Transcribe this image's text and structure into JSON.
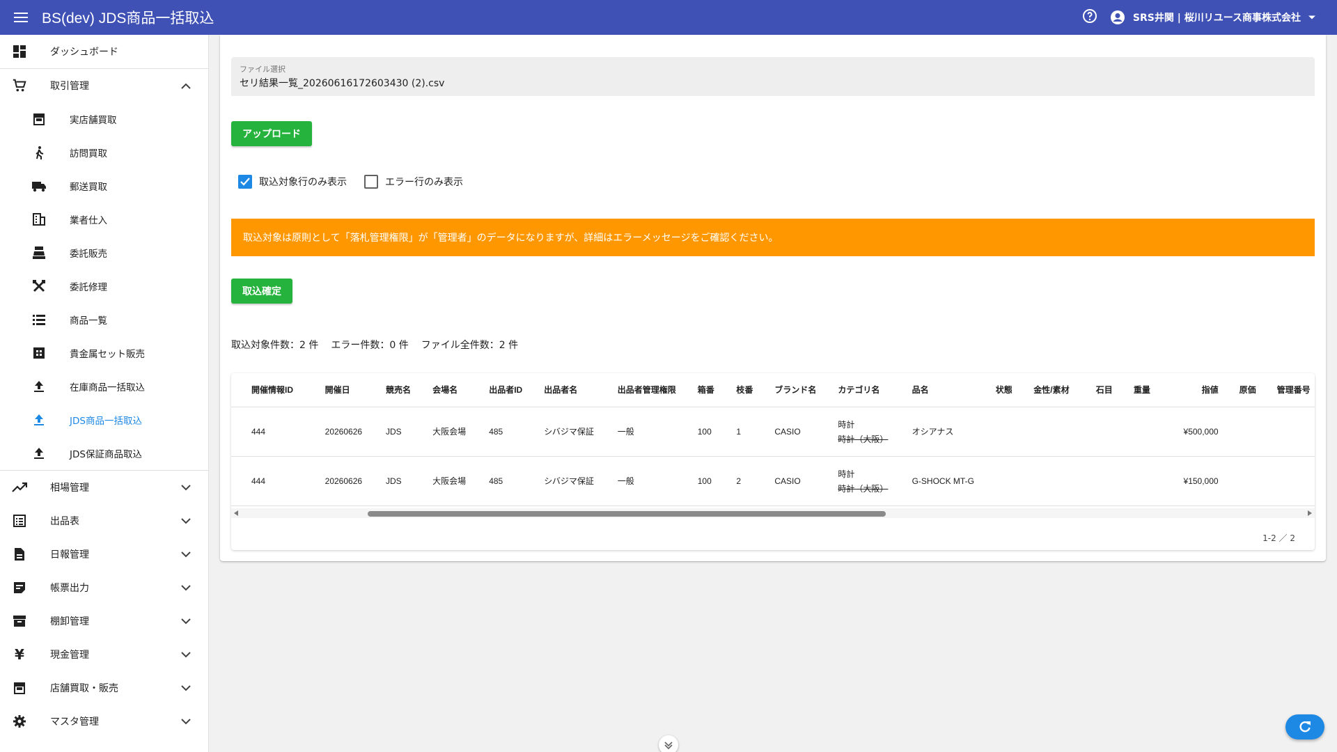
{
  "appbar": {
    "title": "BS(dev) JDS商品一括取込",
    "user": "SRS井関 | 桜川リユース商事株式会社"
  },
  "sidebar": {
    "items": [
      {
        "label": "ダッシュボード",
        "icon": "dashboard-icon"
      },
      {
        "label": "取引管理",
        "icon": "cart-icon"
      },
      {
        "label": "実店舗買取",
        "icon": "store-icon"
      },
      {
        "label": "訪問買取",
        "icon": "walk-icon"
      },
      {
        "label": "郵送買取",
        "icon": "truck-icon"
      },
      {
        "label": "業者仕入",
        "icon": "building-icon"
      },
      {
        "label": "委託販売",
        "icon": "register-icon"
      },
      {
        "label": "委託修理",
        "icon": "tools-icon"
      },
      {
        "label": "商品一覧",
        "icon": "list-icon"
      },
      {
        "label": "貴金属セット販売",
        "icon": "grid-icon"
      },
      {
        "label": "在庫商品一括取込",
        "icon": "upload-icon"
      },
      {
        "label": "JDS商品一括取込",
        "icon": "upload-icon"
      },
      {
        "label": "JDS保証商品取込",
        "icon": "upload-icon"
      },
      {
        "label": "相場管理",
        "icon": "trend-icon"
      },
      {
        "label": "出品表",
        "icon": "listalt-icon"
      },
      {
        "label": "日報管理",
        "icon": "document-icon"
      },
      {
        "label": "帳票出力",
        "icon": "note-icon"
      },
      {
        "label": "棚卸管理",
        "icon": "archive-icon"
      },
      {
        "label": "現金管理",
        "icon": "yen-icon"
      },
      {
        "label": "店舗買取・販売",
        "icon": "store-icon"
      },
      {
        "label": "マスタ管理",
        "icon": "gear-icon"
      }
    ]
  },
  "file": {
    "label": "ファイル選択",
    "value": "セリ結果一覧_20260616172603430 (2).csv"
  },
  "buttons": {
    "upload": "アップロード",
    "confirm": "取込確定"
  },
  "filters": {
    "target_only": "取込対象行のみ表示",
    "target_only_checked": true,
    "error_only": "エラー行のみ表示",
    "error_only_checked": false
  },
  "alert": "取込対象は原則として「落札管理権限」が「管理者」のデータになりますが、詳細はエラーメッセージをご確認ください。",
  "counts": {
    "target": "取込対象件数：2 件",
    "error": "エラー件数：0 件",
    "total": "ファイル全件数：2 件"
  },
  "table": {
    "columns": [
      "開催情報ID",
      "開催日",
      "競売名",
      "会場名",
      "出品者ID",
      "出品者名",
      "出品者管理権限",
      "箱番",
      "枝番",
      "ブランド名",
      "カテゴリ名",
      "品名",
      "状態",
      "金性/素材",
      "石目",
      "重量",
      "指値",
      "原価",
      "管理番号"
    ],
    "rows": [
      {
        "id": "444",
        "date": "20260626",
        "auction": "JDS",
        "venue": "大阪会場",
        "seller_id": "485",
        "seller": "シバジマ保証",
        "role": "一般",
        "box": "100",
        "branch": "1",
        "brand": "CASIO",
        "cat1": "時計",
        "cat2": "時計（大阪）",
        "name": "オシアナス",
        "state": "",
        "material": "",
        "stone": "",
        "weight": "",
        "limit": "¥500,000",
        "cost": "",
        "mgmt": ""
      },
      {
        "id": "444",
        "date": "20260626",
        "auction": "JDS",
        "venue": "大阪会場",
        "seller_id": "485",
        "seller": "シバジマ保証",
        "role": "一般",
        "box": "100",
        "branch": "2",
        "brand": "CASIO",
        "cat1": "時計",
        "cat2": "時計（大阪）",
        "name": "G-SHOCK MT-G",
        "state": "",
        "material": "",
        "stone": "",
        "weight": "",
        "limit": "¥150,000",
        "cost": "",
        "mgmt": ""
      }
    ],
    "pager": "1-2 ／ 2"
  }
}
